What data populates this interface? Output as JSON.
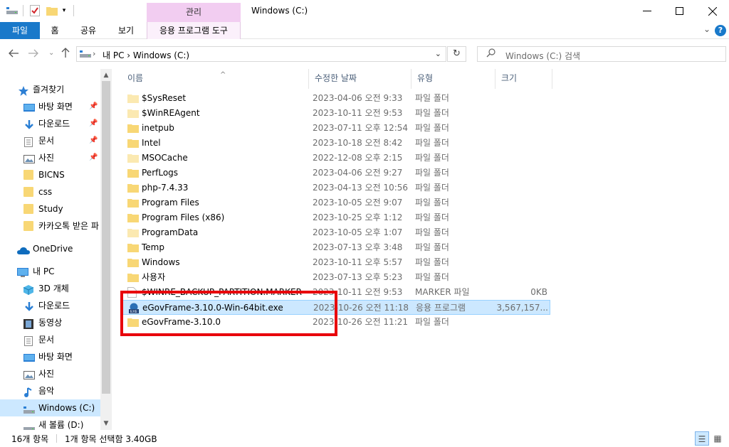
{
  "window": {
    "title": "Windows (C:)",
    "manage_tab": "관리"
  },
  "ribbon": {
    "tabs": [
      {
        "label": "파일"
      },
      {
        "label": "홈"
      },
      {
        "label": "공유"
      },
      {
        "label": "보기"
      },
      {
        "label": "응용 프로그램 도구"
      }
    ]
  },
  "address": {
    "crumbs": "내 PC  ›  Windows (C:)",
    "search_placeholder": "Windows (C:) 검색"
  },
  "nav": {
    "quick_access": "즐겨찾기",
    "items": [
      {
        "label": "바탕 화면",
        "pinned": true
      },
      {
        "label": "다운로드",
        "pinned": true
      },
      {
        "label": "문서",
        "pinned": true
      },
      {
        "label": "사진",
        "pinned": true
      },
      {
        "label": "BICNS"
      },
      {
        "label": "css"
      },
      {
        "label": "Study"
      },
      {
        "label": "카카오톡 받은 파"
      }
    ],
    "onedrive": "OneDrive",
    "this_pc": "내 PC",
    "pc_items": [
      {
        "label": "3D 개체"
      },
      {
        "label": "다운로드"
      },
      {
        "label": "동영상"
      },
      {
        "label": "문서"
      },
      {
        "label": "바탕 화면"
      },
      {
        "label": "사진"
      },
      {
        "label": "음악"
      },
      {
        "label": "Windows (C:)"
      },
      {
        "label": "새 볼륨 (D:)"
      }
    ]
  },
  "columns": {
    "name": "이름",
    "date": "수정한 날짜",
    "type": "유형",
    "size": "크기"
  },
  "files": [
    {
      "name": "$SysReset",
      "date": "2023-04-06 오전 9:33",
      "type": "파일 폴더",
      "size": "",
      "icon": "folder-light"
    },
    {
      "name": "$WinREAgent",
      "date": "2023-10-11 오전 9:53",
      "type": "파일 폴더",
      "size": "",
      "icon": "folder-light"
    },
    {
      "name": "inetpub",
      "date": "2023-07-11 오후 12:54",
      "type": "파일 폴더",
      "size": "",
      "icon": "folder"
    },
    {
      "name": "Intel",
      "date": "2023-10-18 오전 8:42",
      "type": "파일 폴더",
      "size": "",
      "icon": "folder"
    },
    {
      "name": "MSOCache",
      "date": "2022-12-08 오후 2:15",
      "type": "파일 폴더",
      "size": "",
      "icon": "folder-light"
    },
    {
      "name": "PerfLogs",
      "date": "2023-04-06 오전 9:27",
      "type": "파일 폴더",
      "size": "",
      "icon": "folder"
    },
    {
      "name": "php-7.4.33",
      "date": "2023-04-13 오전 10:56",
      "type": "파일 폴더",
      "size": "",
      "icon": "folder"
    },
    {
      "name": "Program Files",
      "date": "2023-10-05 오전 9:07",
      "type": "파일 폴더",
      "size": "",
      "icon": "folder"
    },
    {
      "name": "Program Files (x86)",
      "date": "2023-10-25 오후 1:12",
      "type": "파일 폴더",
      "size": "",
      "icon": "folder"
    },
    {
      "name": "ProgramData",
      "date": "2023-10-05 오후 1:07",
      "type": "파일 폴더",
      "size": "",
      "icon": "folder-light"
    },
    {
      "name": "Temp",
      "date": "2023-07-13 오후 3:48",
      "type": "파일 폴더",
      "size": "",
      "icon": "folder"
    },
    {
      "name": "Windows",
      "date": "2023-10-11 오후 5:57",
      "type": "파일 폴더",
      "size": "",
      "icon": "folder"
    },
    {
      "name": "사용자",
      "date": "2023-07-13 오후 5:23",
      "type": "파일 폴더",
      "size": "",
      "icon": "folder"
    },
    {
      "name": "$WINRE_BACKUP_PARTITION.MARKER",
      "date": "2023-10-11 오전 9:53",
      "type": "MARKER 파일",
      "size": "0KB",
      "icon": "file"
    },
    {
      "name": "eGovFrame-3.10.0-Win-64bit.exe",
      "date": "2023-10-26 오전 11:18",
      "type": "응용 프로그램",
      "size": "3,567,157...",
      "icon": "exe",
      "selected": true
    },
    {
      "name": "eGovFrame-3.10.0",
      "date": "2023-10-26 오전 11:21",
      "type": "파일 폴더",
      "size": "",
      "icon": "folder"
    }
  ],
  "status": {
    "count": "16개 항목",
    "selection": "1개 항목 선택함 3.40GB"
  },
  "colors": {
    "accent": "#1979ca",
    "selection": "#cce8ff",
    "manage_tab": "#f2cdf1",
    "highlight_box": "#e8000b"
  }
}
